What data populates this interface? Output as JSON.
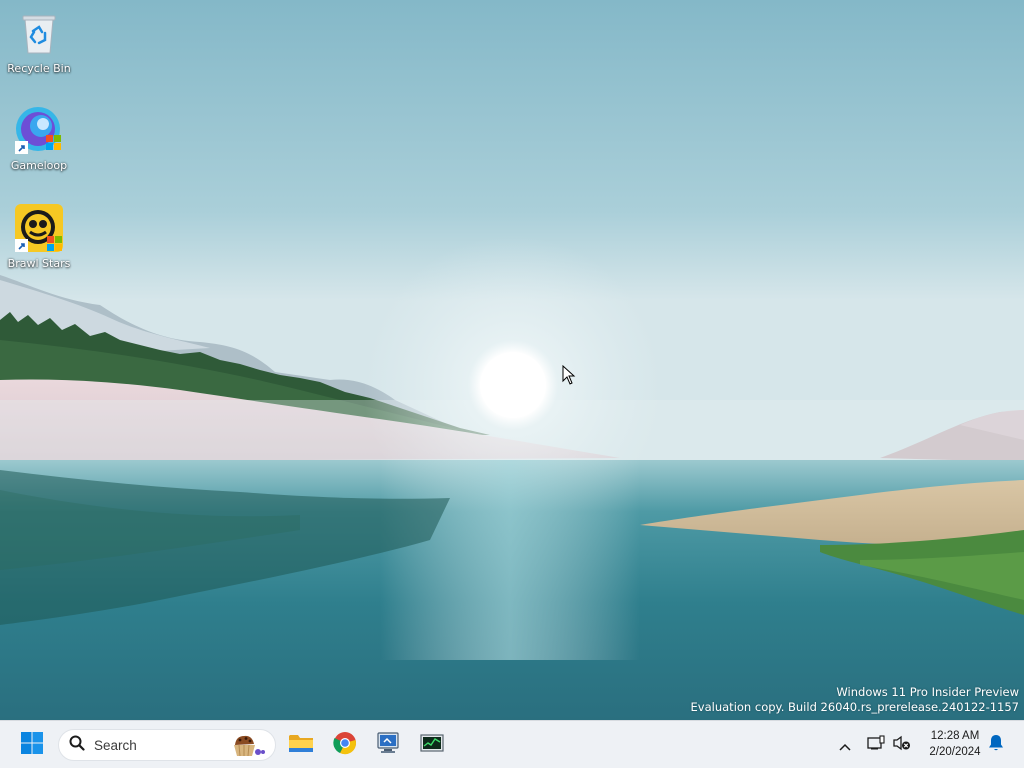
{
  "desktop": {
    "icons": [
      {
        "label": "Recycle Bin",
        "icon": "recycle-bin-icon",
        "shortcut": false
      },
      {
        "label": "Gameloop",
        "icon": "gameloop-icon",
        "shortcut": true
      },
      {
        "label": "Brawl Stars",
        "icon": "brawl-stars-icon",
        "shortcut": true
      }
    ]
  },
  "watermark": {
    "line1": "Windows 11 Pro Insider Preview",
    "line2": "Evaluation copy. Build 26040.rs_prerelease.240122-1157"
  },
  "taskbar": {
    "start_icon": "windows-start-icon",
    "search": {
      "label": "Search",
      "icon": "search-icon"
    },
    "pinned": [
      {
        "name": "File Explorer",
        "icon": "file-explorer-icon"
      },
      {
        "name": "Google Chrome",
        "icon": "chrome-icon"
      },
      {
        "name": "Remote Desktop",
        "icon": "remote-desktop-icon"
      },
      {
        "name": "Task Manager",
        "icon": "task-manager-icon"
      }
    ],
    "tray": {
      "overflow_icon": "chevron-up-icon",
      "network_icon": "network-icon",
      "volume_icon": "volume-muted-icon",
      "notification_icon": "bell-icon"
    },
    "clock": {
      "time": "12:28 AM",
      "date": "2/20/2024"
    }
  },
  "colors": {
    "taskbar_bg": "#eef1f5",
    "accent": "#0067c0",
    "sky": "#8fc0cf"
  }
}
